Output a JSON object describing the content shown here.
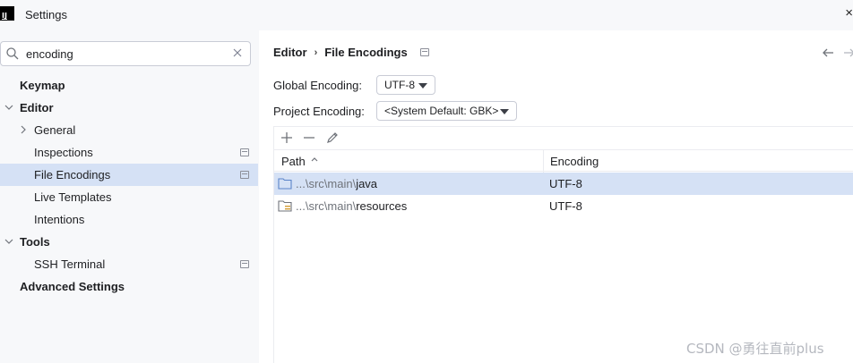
{
  "window": {
    "title": "Settings",
    "app_icon_text": "IJ"
  },
  "search": {
    "value": "encoding",
    "placeholder": ""
  },
  "tree": [
    {
      "label": "Keymap",
      "level": 0,
      "bold": true,
      "arrow": "",
      "project": false,
      "selected": false
    },
    {
      "label": "Editor",
      "level": 0,
      "bold": true,
      "arrow": "down",
      "project": false,
      "selected": false
    },
    {
      "label": "General",
      "level": 1,
      "bold": false,
      "arrow": "right",
      "project": false,
      "selected": false
    },
    {
      "label": "Inspections",
      "level": 1,
      "bold": false,
      "arrow": "",
      "project": true,
      "selected": false
    },
    {
      "label": "File Encodings",
      "level": 1,
      "bold": false,
      "arrow": "",
      "project": true,
      "selected": true
    },
    {
      "label": "Live Templates",
      "level": 1,
      "bold": false,
      "arrow": "",
      "project": false,
      "selected": false
    },
    {
      "label": "Intentions",
      "level": 1,
      "bold": false,
      "arrow": "",
      "project": false,
      "selected": false
    },
    {
      "label": "Tools",
      "level": 0,
      "bold": true,
      "arrow": "down",
      "project": false,
      "selected": false
    },
    {
      "label": "SSH Terminal",
      "level": 1,
      "bold": false,
      "arrow": "",
      "project": true,
      "selected": false
    },
    {
      "label": "Advanced Settings",
      "level": 0,
      "bold": true,
      "arrow": "",
      "project": false,
      "selected": false
    }
  ],
  "breadcrumb": {
    "parent": "Editor",
    "separator": "›",
    "current": "File Encodings"
  },
  "global_encoding": {
    "label": "Global Encoding:",
    "value": "UTF-8"
  },
  "project_encoding": {
    "label": "Project Encoding:",
    "value": "<System Default: GBK>"
  },
  "table": {
    "columns": [
      "Path",
      "Encoding"
    ],
    "rows": [
      {
        "path_prefix": "...\\src\\main\\",
        "path_name": "java",
        "encoding": "UTF-8",
        "selected": true,
        "icon": "folder-icon"
      },
      {
        "path_prefix": "...\\src\\main\\",
        "path_name": "resources",
        "encoding": "UTF-8",
        "selected": false,
        "icon": "resources-folder-icon"
      }
    ]
  },
  "watermark": "CSDN @勇往直前plus",
  "colors": {
    "selection": "#d5e1f5",
    "panel": "#f7f8fa",
    "border": "#c9ccd6"
  }
}
